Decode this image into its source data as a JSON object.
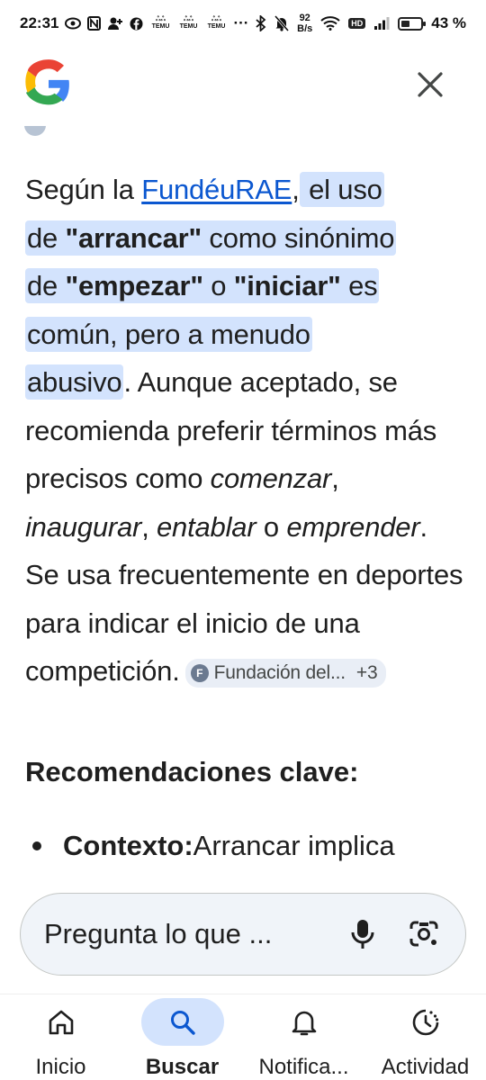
{
  "status_bar": {
    "time": "22:31",
    "temu_labels": [
      "TEMU",
      "TEMU",
      "TEMU"
    ],
    "more": "···",
    "net_speed_value": "92",
    "net_speed_unit": "B/s",
    "hd": "HD",
    "battery_percent": "43 %",
    "battery_level": 0.43
  },
  "header": {
    "logo": "google-g-logo",
    "close_icon": "close-icon"
  },
  "answer": {
    "p1_before_link": "Según la ",
    "link": "FundéuRAE",
    "p1_comma": ",",
    "h_el_uso": " el uso",
    "h_de": "de ",
    "h_arrancar": "\"arrancar\"",
    "h_como": " como sinónimo",
    "h_de2": "de ",
    "h_empezar": "\"empezar\"",
    "h_o": " o ",
    "h_iniciar": "\"iniciar\"",
    "h_es": " es",
    "h_comun": "común, pero a menudo",
    "h_abusivo": "abusivo",
    "after_highlight": ". Aunque aceptado, se recomienda preferir términos más precisos como ",
    "i_comenzar": "comenzar",
    "comma1": ", ",
    "i_inaugurar": "inaugurar",
    "comma2": ", ",
    "i_entablar": "entablar",
    "o": " o ",
    "i_emprender": "emprender",
    "rest": ". Se usa frecuentemente en deportes para indicar el inicio de una competición.",
    "source_chip_label": "Fundación del...",
    "source_chip_icon_letter": "F",
    "source_chip_count": "+3"
  },
  "section": {
    "title": "Recomendaciones clave:",
    "bullet_label": "Contexto:",
    "bullet_text": " Arrancar implica"
  },
  "search": {
    "placeholder": "Pregunta lo que ..."
  },
  "bottom_nav": {
    "items": [
      {
        "label": "Inicio",
        "icon": "home-icon"
      },
      {
        "label": "Buscar",
        "icon": "search-icon"
      },
      {
        "label": "Notifica...",
        "icon": "bell-icon"
      },
      {
        "label": "Actividad",
        "icon": "activity-icon"
      }
    ],
    "active_index": 1
  },
  "colors": {
    "highlight": "#d3e3fd",
    "link": "#0b57d0",
    "active_pill": "#d3e3fd",
    "google_blue": "#4285F4",
    "google_red": "#EA4335",
    "google_yellow": "#FBBC05",
    "google_green": "#34A853"
  }
}
